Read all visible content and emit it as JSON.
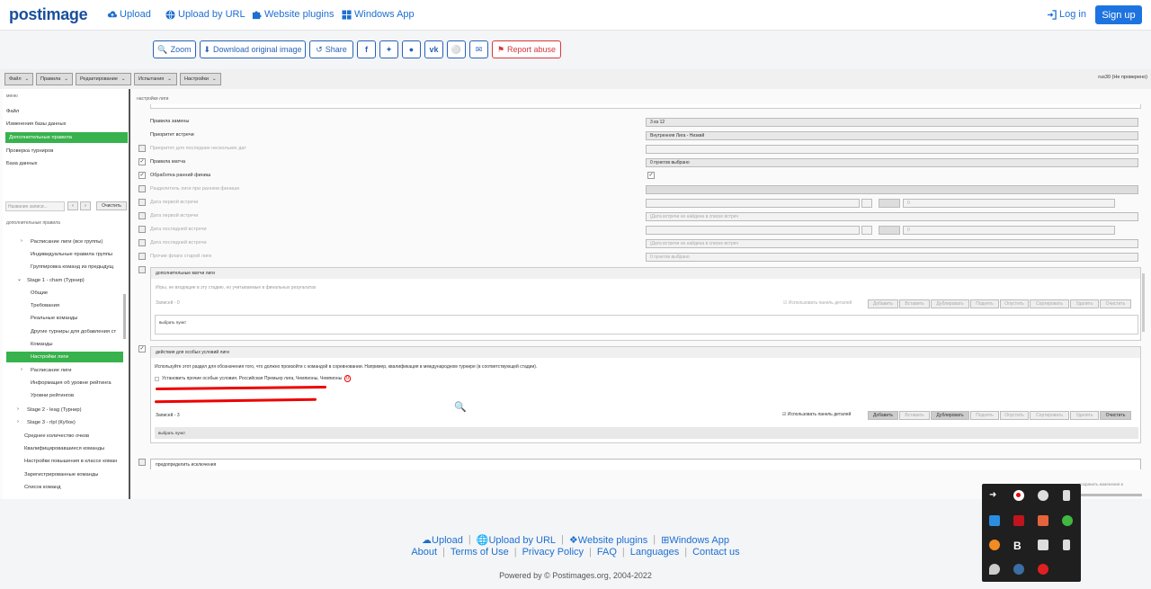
{
  "header": {
    "logo": "postimage",
    "nav": [
      "Upload",
      "Upload by URL",
      "Website plugins",
      "Windows App"
    ],
    "login": "Log in",
    "signup": "Sign up"
  },
  "toolbar": {
    "zoom": "Zoom",
    "download": "Download original image",
    "share": "Share",
    "report": "Report abuse"
  },
  "app": {
    "menus": [
      "Файл",
      "Правила",
      "Редактирование",
      "Испытания",
      "Настройки"
    ],
    "user": "rus30 (Не проверено)",
    "left_title": "меню",
    "left_menu": [
      "Файл",
      "Изменения базы данных",
      "Дополнительные правила",
      "Проверка турниров",
      "База данных"
    ],
    "search_placeholder": "Название записи...",
    "clear": "Очистить",
    "section": "дополнительные правила",
    "tree": [
      "Расписание лиги (все группы)",
      "Индивидуальные правила группы",
      "Группировка команд из предыдущ",
      "Stage 1 - cham (Турнир)",
      "Общие",
      "Требования",
      "Реальные команды",
      "Другие турниры для добавления ст",
      "Команды",
      "Настройки лиги",
      "Расписание лиги",
      "Информация об уровне рейтинга",
      "Уровни рейтингов",
      "Stage 2 - leag (Турнир)",
      "Stage 3 - rlpl (Кубок)",
      "Среднее количество очков",
      "Квалифицировавшиеся команды",
      "Настройки повышения в классе коман",
      "Зарегистрированные команды",
      "Список команд"
    ],
    "right_title": "настройки лиги",
    "rows": [
      {
        "label": "Правила замены",
        "value": "3 из 12"
      },
      {
        "label": "Приоритет встречи",
        "value": "Внутренняя Лига - Низкий"
      },
      {
        "label": "Приоритет для последних нескольких дат",
        "value": ""
      },
      {
        "label": "Правила матча",
        "value": "0 пунктов выбрано"
      },
      {
        "label": "Обработка ранний финиш",
        "value": ""
      },
      {
        "label": "Разделитель лиги при раннем финише",
        "value": ""
      },
      {
        "label": "Дата первой встречи",
        "value": "0"
      },
      {
        "label": "Дата первой встречи",
        "value": "(Дата встречи не найдена в списке встреч"
      },
      {
        "label": "Дата последней встречи",
        "value": "0"
      },
      {
        "label": "Дата последней встречи",
        "value": "(Дата встречи не найдена в списке встреч"
      },
      {
        "label": "Прочие флаги старой лиги",
        "value": "0 пунктов выбрано"
      }
    ],
    "box1_title": "дополнительные матчи лиги",
    "box1_desc": "Игры, не входящие в эту стадию, но учитываемые в финальных результатах",
    "box1_count": "Записей - 0",
    "use_panel": "Использовать панель деталей",
    "actions": [
      "Добавить",
      "Вставить",
      "Дублировать",
      "Поднять",
      "Опустить",
      "Сортировать",
      "Удалить",
      "Очистить"
    ],
    "choose": "выбрать пункт",
    "box2_title": "действия для особых условий лиги",
    "box2_desc": "Используйте этот раздел для обозначения того, что должно произойти с командой в соревновании. Например, квалификация в международном турнире (в соответствующей стадии).",
    "box2_item": "Установить прочие особые условия. Российская Премьер лига, Чемпионы, Чемпионы",
    "box2_badge": "0",
    "box2_count": "Записей - 3",
    "box3_title": "предопределить исключения",
    "edit_note": "сохранить изменения в"
  },
  "footer": {
    "links1": [
      "Upload",
      "Upload by URL",
      "Website plugins",
      "Windows App"
    ],
    "links2": [
      "About",
      "Terms of Use",
      "Privacy Policy",
      "FAQ",
      "Languages",
      "Contact us"
    ],
    "copyright": "Powered by © Postimages.org, 2004-2022"
  },
  "colors": {
    "accent": "#1d74e0",
    "link": "#1d6fd1",
    "selected": "#37b24d",
    "danger": "#d9363e"
  }
}
